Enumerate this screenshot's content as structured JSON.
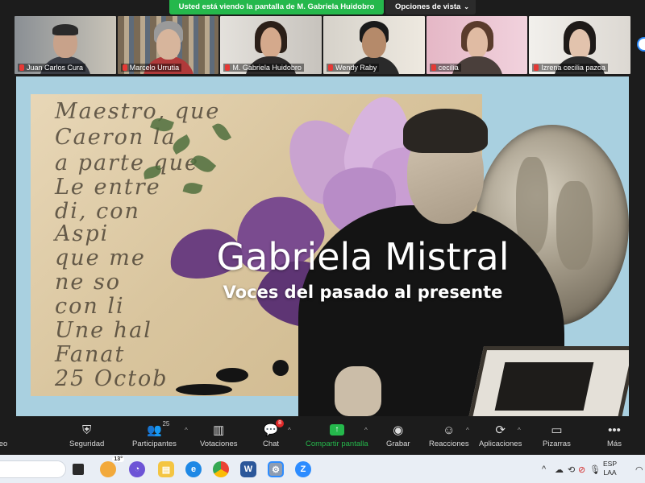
{
  "share_banner": {
    "viewing_text": "Usted está viendo la pantalla de M. Gabriela Huidobro",
    "view_options_label": "Opciones de vista"
  },
  "participants": [
    {
      "name": "Juan Carlos Cura"
    },
    {
      "name": "Marcelo Urrutia"
    },
    {
      "name": "M. Gabriela Huidobro"
    },
    {
      "name": "Wendy Raby"
    },
    {
      "name": "cecilia"
    },
    {
      "name": "Izrena cecilia pazoa"
    }
  ],
  "slide": {
    "title": "Gabriela Mistral",
    "subtitle": "Voces del pasado al presente",
    "script_lines": [
      "Maestro, que",
      "Caeron la",
      "a parte que",
      "Le entre",
      "di, con",
      "Aspi",
      "que me",
      "ne so",
      "con li",
      "Une hal",
      "Fanat",
      "25 Octob"
    ]
  },
  "toolbar": {
    "left_cut_label": "eo",
    "security": "Seguridad",
    "participants": "Participantes",
    "participants_count": "25",
    "polls": "Votaciones",
    "chat": "Chat",
    "chat_badge": "8",
    "share": "Compartir pantalla",
    "record": "Grabar",
    "reactions": "Reacciones",
    "apps": "Aplicaciones",
    "whiteboards": "Pizarras",
    "more": "Más"
  },
  "taskbar": {
    "weather_badge": "13°",
    "word_letter": "W",
    "zoom_letter": "Z",
    "lang_line1": "ESP",
    "lang_line2": "LAA"
  },
  "colors": {
    "zoom_green": "#25b84c",
    "mute_red": "#e53935",
    "slide_bg": "#a9d0e0"
  }
}
